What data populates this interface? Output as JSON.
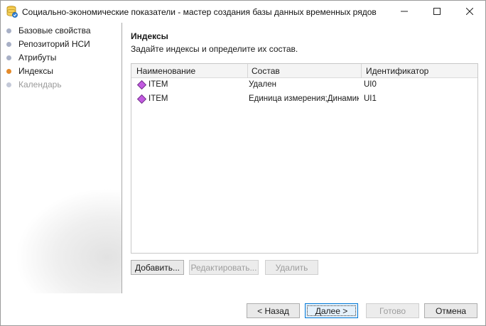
{
  "window": {
    "title": "Социально-экономические показатели - мастер создания базы данных временных рядов",
    "icon": "database-wizard-icon"
  },
  "sidebar": {
    "items": [
      {
        "label": "Базовые свойства",
        "state": "done",
        "dot_color": "#a8b0c6"
      },
      {
        "label": "Репозиторий НСИ",
        "state": "done",
        "dot_color": "#a8b0c6"
      },
      {
        "label": "Атрибуты",
        "state": "done",
        "dot_color": "#a8b0c6"
      },
      {
        "label": "Индексы",
        "state": "current",
        "dot_color": "#e48a2a"
      },
      {
        "label": "Календарь",
        "state": "pending",
        "dot_color": "#a8b0c6"
      }
    ]
  },
  "main": {
    "heading": "Индексы",
    "subheading": "Задайте индексы и определите их состав.",
    "table": {
      "columns": [
        "Наименование",
        "Состав",
        "Идентификатор"
      ],
      "rows": [
        {
          "name": "ITEM",
          "composition": "Удален",
          "id": "UI0"
        },
        {
          "name": "ITEM",
          "composition": "Единица измерения;Динамика",
          "id": "UI1"
        }
      ],
      "row_icon_color": "#c25ae0"
    },
    "actions": {
      "add": "Добавить...",
      "edit": "Редактировать...",
      "delete": "Удалить"
    }
  },
  "footer": {
    "back": "< Назад",
    "next": "Далее >",
    "finish": "Готово",
    "cancel": "Отмена"
  }
}
